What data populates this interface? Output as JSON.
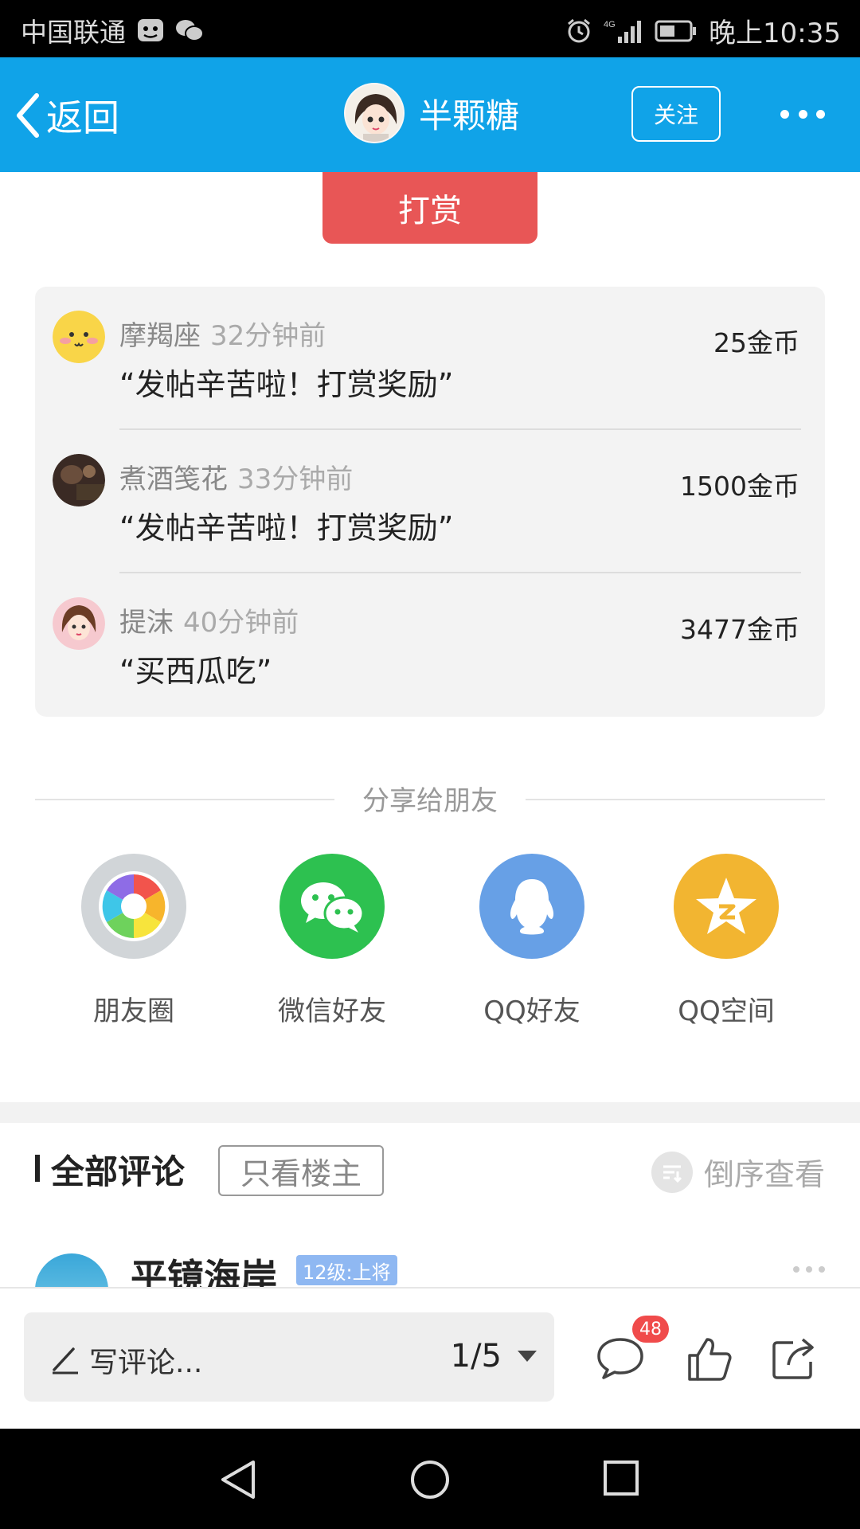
{
  "status_bar": {
    "carrier": "中国联通",
    "network": "4G",
    "time": "晚上10:35"
  },
  "nav": {
    "back_label": "返回",
    "username": "半颗糖",
    "follow_label": "关注"
  },
  "reward_button": "打赏",
  "rewards": [
    {
      "name": "摩羯座",
      "time": "32分钟前",
      "message": "“发帖辛苦啦！打赏奖励”",
      "amount": "25金币"
    },
    {
      "name": "煮酒笺花",
      "time": "33分钟前",
      "message": "“发帖辛苦啦！打赏奖励”",
      "amount": "1500金币"
    },
    {
      "name": "提沫",
      "time": "40分钟前",
      "message": "“买西瓜吃”",
      "amount": "3477金币"
    }
  ],
  "share": {
    "title": "分享给朋友",
    "items": [
      {
        "label": "朋友圈",
        "color": "#CFD3D6"
      },
      {
        "label": "微信好友",
        "color": "#2DC150"
      },
      {
        "label": "QQ好友",
        "color": "#67A0E6"
      },
      {
        "label": "QQ空间",
        "color": "#F2B531"
      }
    ]
  },
  "comments": {
    "title": "全部评论",
    "owner_only": "只看楼主",
    "sort_label": "倒序查看",
    "first": {
      "name": "平镜海岸",
      "badge": "12级:上将"
    }
  },
  "toolbar": {
    "write_placeholder": "写评论...",
    "page": "1/5",
    "comment_count": "48"
  },
  "colors": {
    "nav_bg": "#10A3E8",
    "reward_btn": "#E85656",
    "badge": "#F04B4B"
  }
}
